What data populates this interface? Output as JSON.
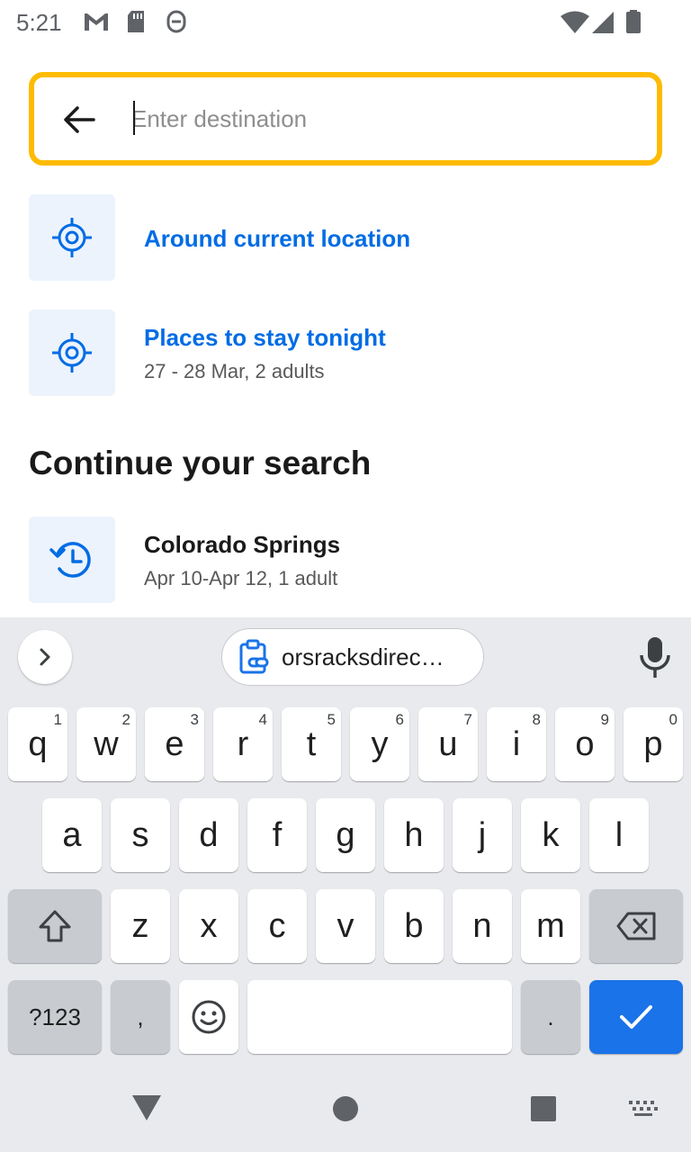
{
  "status_bar": {
    "time": "5:21",
    "left_icons": [
      "gmail-icon",
      "sd-card-icon",
      "app-notification-icon"
    ],
    "right_icons": [
      "wifi-icon",
      "signal-icon",
      "battery-icon"
    ]
  },
  "search": {
    "placeholder": "Enter destination",
    "value": "",
    "border_color": "#febb02"
  },
  "quick_options": [
    {
      "title": "Around current location",
      "subtitle": "",
      "icon": "location-target-icon"
    },
    {
      "title": "Places to stay tonight",
      "subtitle": "27 - 28 Mar, 2 adults",
      "icon": "location-target-icon"
    }
  ],
  "recent": {
    "heading": "Continue your search",
    "items": [
      {
        "title": "Colorado Springs",
        "subtitle": "Apr 10-Apr 12, 1 adult",
        "icon": "history-icon"
      }
    ]
  },
  "keyboard": {
    "clipboard_suggestion": "orsracksdirec…",
    "row1": [
      {
        "key": "q",
        "hint": "1"
      },
      {
        "key": "w",
        "hint": "2"
      },
      {
        "key": "e",
        "hint": "3"
      },
      {
        "key": "r",
        "hint": "4"
      },
      {
        "key": "t",
        "hint": "5"
      },
      {
        "key": "y",
        "hint": "6"
      },
      {
        "key": "u",
        "hint": "7"
      },
      {
        "key": "i",
        "hint": "8"
      },
      {
        "key": "o",
        "hint": "9"
      },
      {
        "key": "p",
        "hint": "0"
      }
    ],
    "row2": [
      "a",
      "s",
      "d",
      "f",
      "g",
      "h",
      "j",
      "k",
      "l"
    ],
    "row3": [
      "z",
      "x",
      "c",
      "v",
      "b",
      "n",
      "m"
    ],
    "symbols_key": "?123",
    "comma_key": ",",
    "period_key": ".",
    "action_color": "#1a73e8"
  },
  "colors": {
    "accent_blue": "#006ce4",
    "icon_box_bg": "#ecf3fd",
    "keyboard_bg": "#e8eaed"
  }
}
